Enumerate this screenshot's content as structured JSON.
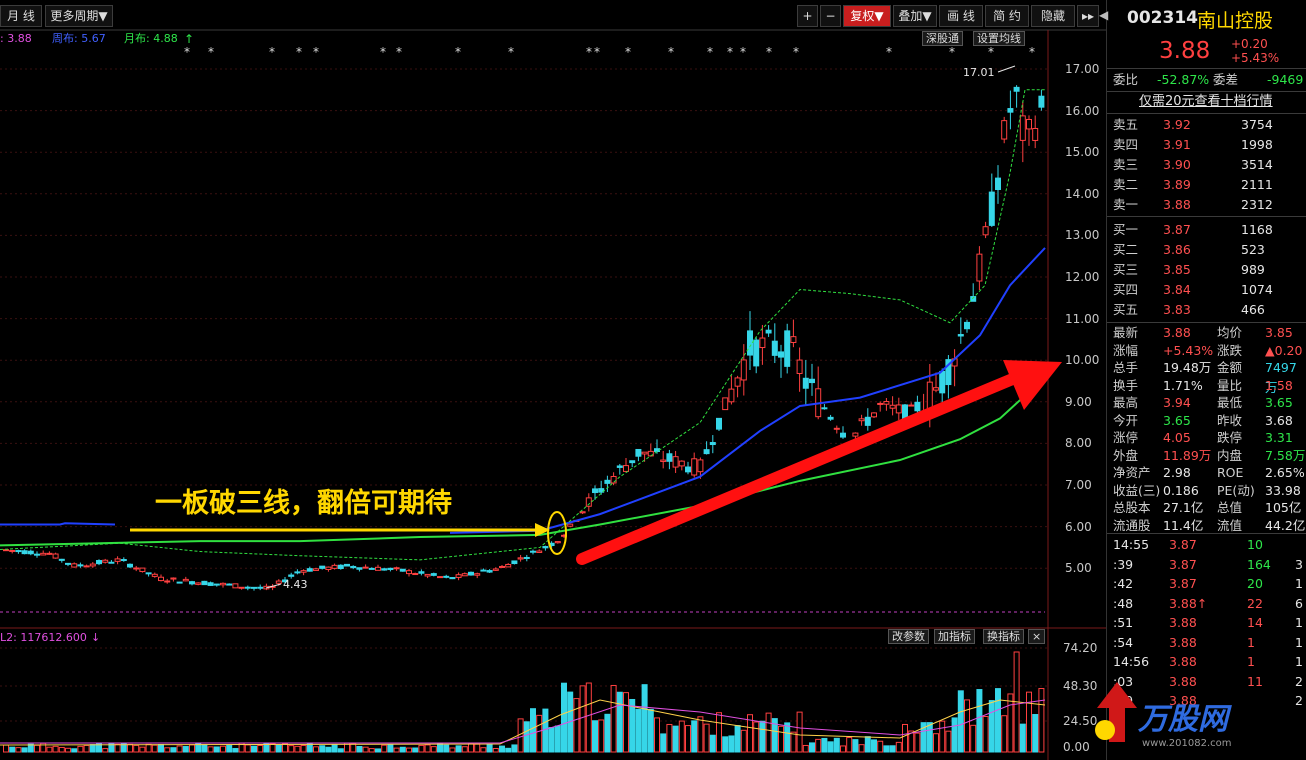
{
  "toolbar": {
    "period": "月 线",
    "more_periods": "更多周期",
    "plus": "+",
    "minus": "−",
    "fuquan": "复权",
    "overlay": "叠加",
    "draw": "画 线",
    "simple": "简 约",
    "hide": "隐藏"
  },
  "legend": {
    "ma1": ": 3.88",
    "ma2": "周布: 5.67",
    "ma3": "月布: 4.88",
    "arrow": "↑"
  },
  "chart_buttons": {
    "deep": "深股通",
    "ma_settings": "设置均线"
  },
  "volume_header": {
    "label": "L2: 117612.600",
    "arrow": "↓",
    "param": "改参数",
    "add": "加指标",
    "swap": "换指标",
    "close": "×"
  },
  "price_axis": [
    "17.00",
    "16.00",
    "15.00",
    "14.00",
    "13.00",
    "12.00",
    "11.00",
    "10.00",
    "9.00",
    "8.00",
    "7.00",
    "6.00",
    "5.00"
  ],
  "volume_axis": [
    "74.20",
    "48.30",
    "24.50",
    "0.00"
  ],
  "annotations": {
    "high": "17.01",
    "low": "4.43",
    "headline": "一板破三线，翻倍可期待"
  },
  "stock": {
    "code": "002314",
    "name": "南山控股",
    "price": "3.88",
    "change": "+0.20",
    "change_pct": "+5.43%"
  },
  "weibi": {
    "label1": "委比",
    "value1": "-52.87%",
    "label2": "委差",
    "value2": "-9469"
  },
  "promo": "仅需20元查看十档行情",
  "sell": [
    {
      "label": "卖五",
      "price": "3.92",
      "vol": "3754"
    },
    {
      "label": "卖四",
      "price": "3.91",
      "vol": "1998"
    },
    {
      "label": "卖三",
      "price": "3.90",
      "vol": "3514"
    },
    {
      "label": "卖二",
      "price": "3.89",
      "vol": "2111"
    },
    {
      "label": "卖一",
      "price": "3.88",
      "vol": "2312"
    }
  ],
  "buy": [
    {
      "label": "买一",
      "price": "3.87",
      "vol": "1168"
    },
    {
      "label": "买二",
      "price": "3.86",
      "vol": "523"
    },
    {
      "label": "买三",
      "price": "3.85",
      "vol": "989"
    },
    {
      "label": "买四",
      "price": "3.84",
      "vol": "1074"
    },
    {
      "label": "买五",
      "price": "3.83",
      "vol": "466"
    }
  ],
  "stats": [
    {
      "l1": "最新",
      "v1": "3.88",
      "c1": "red",
      "l2": "均价",
      "v2": "3.85",
      "c2": "red"
    },
    {
      "l1": "涨幅",
      "v1": "+5.43%",
      "c1": "red",
      "l2": "涨跌",
      "v2": "▲0.20",
      "c2": "red"
    },
    {
      "l1": "总手",
      "v1": "19.48万",
      "c1": "white",
      "l2": "金额",
      "v2": "7497万",
      "c2": "cyan"
    },
    {
      "l1": "换手",
      "v1": "1.71%",
      "c1": "white",
      "l2": "量比",
      "v2": "1.58",
      "c2": "red"
    },
    {
      "l1": "最高",
      "v1": "3.94",
      "c1": "red",
      "l2": "最低",
      "v2": "3.65",
      "c2": "green"
    },
    {
      "l1": "今开",
      "v1": "3.65",
      "c1": "green",
      "l2": "昨收",
      "v2": "3.68",
      "c2": "white"
    },
    {
      "l1": "涨停",
      "v1": "4.05",
      "c1": "red",
      "l2": "跌停",
      "v2": "3.31",
      "c2": "green"
    },
    {
      "l1": "外盘",
      "v1": "11.89万",
      "c1": "red",
      "l2": "内盘",
      "v2": "7.58万",
      "c2": "green"
    },
    {
      "l1": "净资产",
      "v1": "2.98",
      "c1": "white",
      "l2": "ROE",
      "v2": "2.65%",
      "c2": "white"
    },
    {
      "l1": "收益(三)",
      "v1": "0.186",
      "c1": "white",
      "l2": "PE(动)",
      "v2": "33.98",
      "c2": "white"
    },
    {
      "l1": "总股本",
      "v1": "27.1亿",
      "c1": "white",
      "l2": "总值",
      "v2": "105亿",
      "c2": "white"
    },
    {
      "l1": "流通股",
      "v1": "11.4亿",
      "c1": "white",
      "l2": "流值",
      "v2": "44.2亿",
      "c2": "white"
    }
  ],
  "ticks": [
    {
      "t": "14:55",
      "p": "3.87",
      "v": "10",
      "e": "",
      "vc": "green",
      "ec": ""
    },
    {
      "t": ":39",
      "p": "3.87",
      "v": "164",
      "e": "3",
      "vc": "green",
      "ec": "white"
    },
    {
      "t": ":42",
      "p": "3.87",
      "v": "20",
      "e": "1",
      "vc": "green",
      "ec": "white"
    },
    {
      "t": ":48",
      "p": "3.88↑",
      "v": "22",
      "e": "6",
      "vc": "red",
      "ec": "white"
    },
    {
      "t": ":51",
      "p": "3.88",
      "v": "14",
      "e": "1",
      "vc": "red",
      "ec": "white"
    },
    {
      "t": ":54",
      "p": "3.88",
      "v": "1",
      "e": "1",
      "vc": "red",
      "ec": "white"
    },
    {
      "t": "14:56",
      "p": "3.88",
      "v": "1",
      "e": "1",
      "vc": "red",
      "ec": "white"
    },
    {
      "t": ":03",
      "p": "3.88",
      "v": "11",
      "e": "2",
      "vc": "red",
      "ec": "white"
    },
    {
      "t": ":09",
      "p": "3.88",
      "v": "",
      "e": "2",
      "vc": "red",
      "ec": "white"
    }
  ],
  "watermark": {
    "brand": "万股网",
    "url": "www.201082.com"
  }
}
